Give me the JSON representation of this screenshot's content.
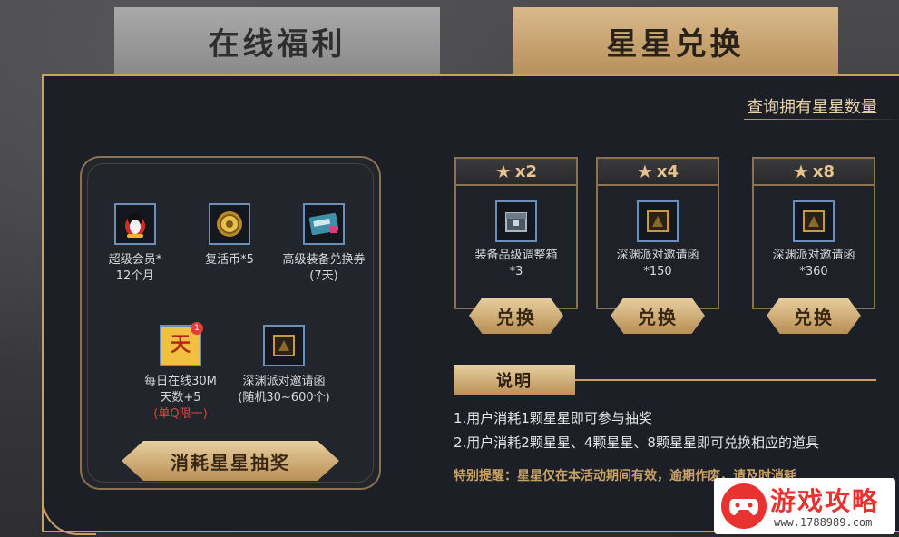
{
  "tabs": [
    {
      "label": "在线福利",
      "active": false
    },
    {
      "label": "星星兑换",
      "active": true
    }
  ],
  "query_label": "查询拥有星星数量",
  "lottery": {
    "prizes": [
      {
        "line1": "超级会员*",
        "line2": "12个月",
        "icon": "qq-penguin-icon"
      },
      {
        "line1": "复活币*5",
        "line2": "",
        "icon": "revive-coin-icon"
      },
      {
        "line1": "高级装备兑换券",
        "line2": "(7天)",
        "icon": "equipment-ticket-icon"
      },
      {
        "line1": "每日在线30M",
        "line2": "天数+5",
        "line3": "(单Q限一)",
        "icon": "day-bonus-icon",
        "badge": "1",
        "glyph": "天"
      },
      {
        "line1": "深渊派对邀请函",
        "line2": "(随机30~600个)",
        "icon": "abyss-invitation-icon"
      }
    ],
    "button_label": "消耗星星抽奖"
  },
  "exchange": [
    {
      "cost": "x2",
      "item_line1": "装备品级调整箱",
      "item_line2": "*3",
      "icon": "grade-box-icon",
      "button": "兑换"
    },
    {
      "cost": "x4",
      "item_line1": "深渊派对邀请函",
      "item_line2": "*150",
      "icon": "abyss-invitation-icon",
      "button": "兑换"
    },
    {
      "cost": "x8",
      "item_line1": "深渊派对邀请函",
      "item_line2": "*360",
      "icon": "abyss-invitation-icon",
      "button": "兑换"
    }
  ],
  "explain": {
    "title": "说明",
    "line1": "1.用户消耗1颗星星即可参与抽奖",
    "line2": "2.用户消耗2颗星星、4颗星星、8颗星星即可兑换相应的道具",
    "tip": "特别提醒：星星仅在本活动期间有效，逾期作废，请及时消耗"
  },
  "watermark": {
    "title": "游戏攻略",
    "url": "www.1788989.com"
  },
  "colors": {
    "gold": "#c7a063",
    "panel": "#1d1f26",
    "limit_red": "#d9453e"
  }
}
